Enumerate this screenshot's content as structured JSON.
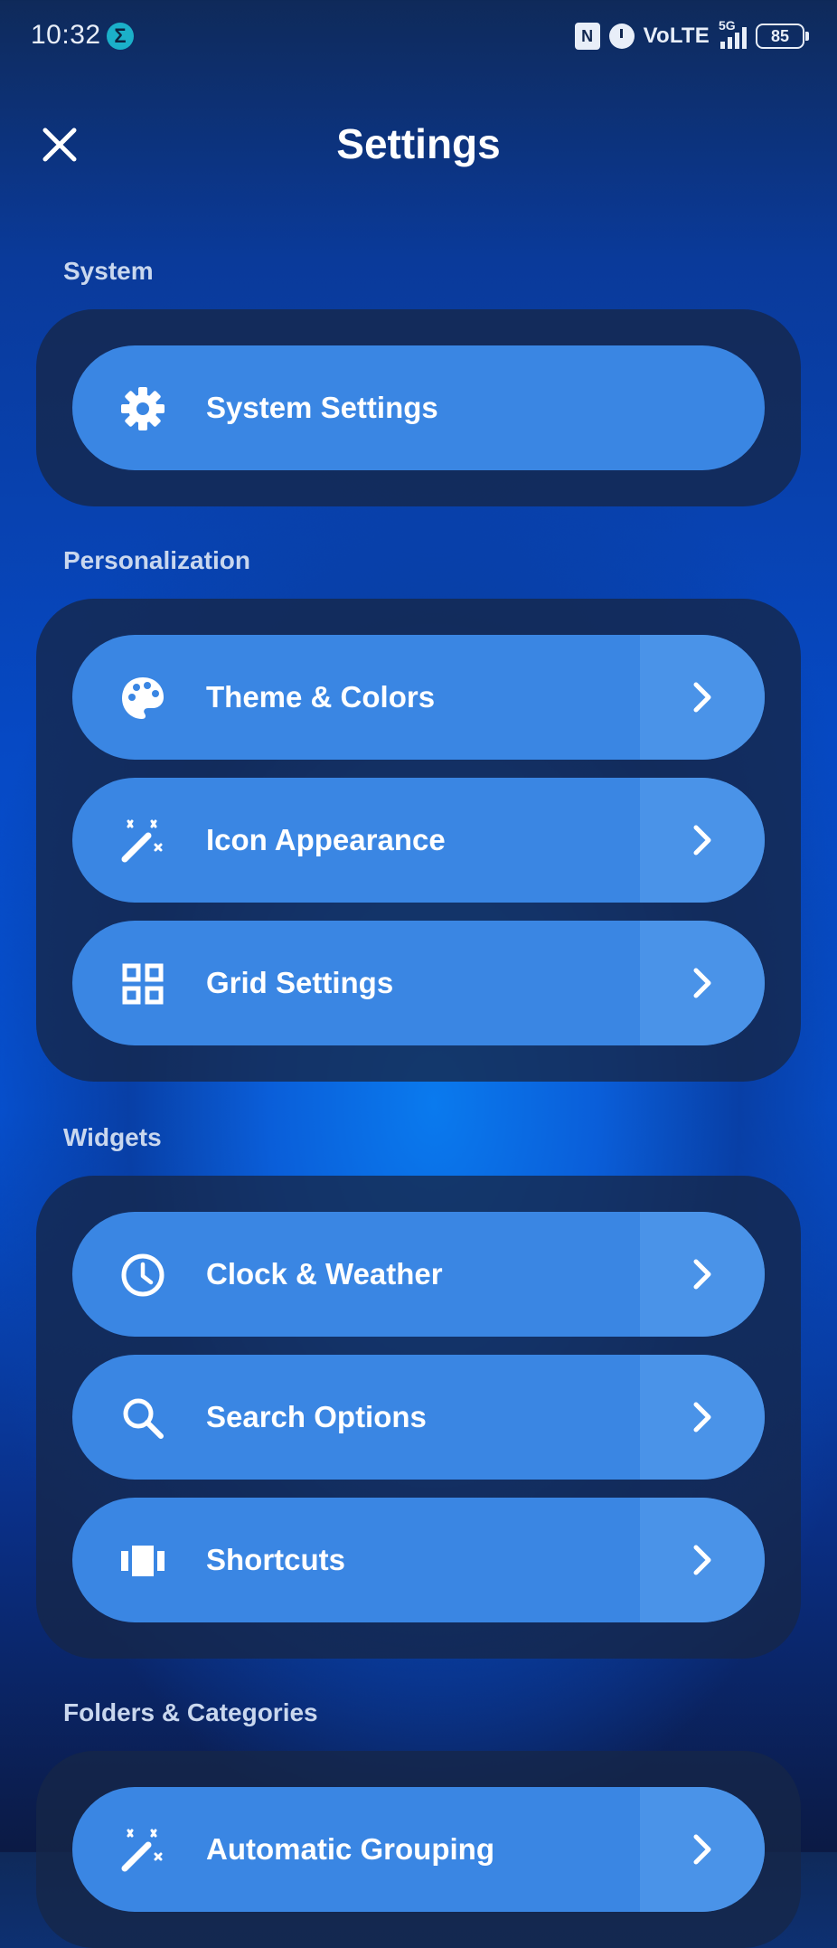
{
  "status_bar": {
    "time": "10:32",
    "network": "VoLTE",
    "net_type": "5G",
    "battery": "85"
  },
  "header": {
    "title": "Settings"
  },
  "sections": [
    {
      "label": "System",
      "items": [
        {
          "label": "System Settings",
          "icon": "gear-icon",
          "has_arrow": false
        }
      ]
    },
    {
      "label": "Personalization",
      "items": [
        {
          "label": "Theme & Colors",
          "icon": "palette-icon",
          "has_arrow": true
        },
        {
          "label": "Icon Appearance",
          "icon": "magic-wand-icon",
          "has_arrow": true
        },
        {
          "label": "Grid Settings",
          "icon": "grid-icon",
          "has_arrow": true
        }
      ]
    },
    {
      "label": "Widgets",
      "items": [
        {
          "label": "Clock & Weather",
          "icon": "clock-icon",
          "has_arrow": true
        },
        {
          "label": "Search Options",
          "icon": "search-icon",
          "has_arrow": true
        },
        {
          "label": "Shortcuts",
          "icon": "shortcuts-icon",
          "has_arrow": true
        }
      ]
    },
    {
      "label": "Folders & Categories",
      "items": [
        {
          "label": "Automatic Grouping",
          "icon": "magic-wand-icon",
          "has_arrow": true
        }
      ]
    }
  ],
  "colors": {
    "item": "#3a86e3",
    "item_arrow": "#4a93e8",
    "group": "#162648",
    "section_label": "#c9d7ee"
  }
}
